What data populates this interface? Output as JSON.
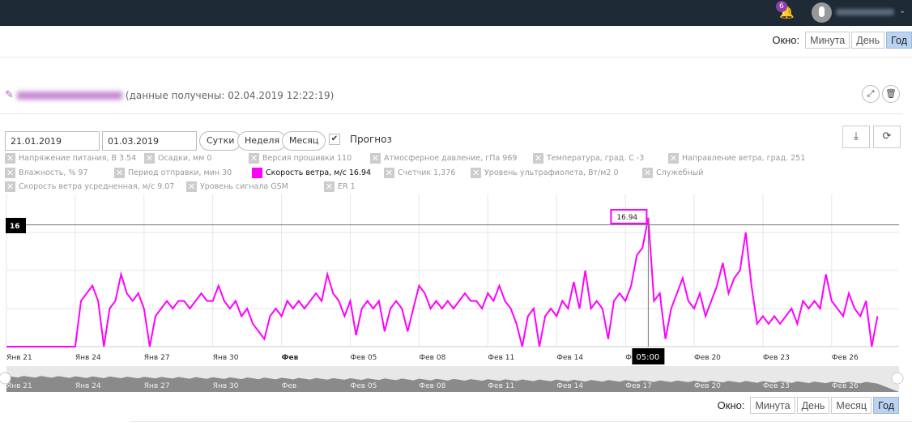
{
  "header": {
    "notifications": "6"
  },
  "window_top": {
    "label": "Окно:",
    "options": [
      "Минута",
      "День",
      "Год"
    ],
    "active": "Год"
  },
  "station": {
    "received": "(данные получены: 02.04.2019 12:22:19)"
  },
  "controls": {
    "date_from": "21.01.2019",
    "date_to": "01.03.2019",
    "ranges": [
      "Сутки",
      "Неделя",
      "Месяц"
    ],
    "forecast_label": "Прогноз",
    "forecast_checked": true
  },
  "legend": [
    {
      "label": "Напряжение питания, В 3.54",
      "on": false
    },
    {
      "label": "Осадки, мм 0",
      "on": false
    },
    {
      "label": "Версия прошивки 110",
      "on": false
    },
    {
      "label": "Атмосферное давление, гПа 969",
      "on": false
    },
    {
      "label": "Температура, град. С -3",
      "on": false
    },
    {
      "label": "Направление ветра, град. 251",
      "on": false
    },
    {
      "label": "Влажность, % 97",
      "on": false
    },
    {
      "label": "Период отправки, мин 30",
      "on": false
    },
    {
      "label": "Скорость ветра, м/с 16.94",
      "on": true,
      "color": "#ff00ff"
    },
    {
      "label": "Счетчик 1,376",
      "on": false
    },
    {
      "label": "Уровень ультрафиолета, Вт/м2 0",
      "on": false
    },
    {
      "label": "Служебный",
      "on": false
    },
    {
      "label": "Скорость ветра усредненная, м/с 9.07",
      "on": false
    },
    {
      "label": "Уровень сигнала GSM",
      "on": false
    },
    {
      "label": "ER 1",
      "on": false
    }
  ],
  "chart_data": {
    "type": "line",
    "series_color": "#ff00ff",
    "x_range": [
      "2019-01-21",
      "2019-02-28T23:00"
    ],
    "y_range": [
      0,
      17.5
    ],
    "y_grid": [
      0,
      5,
      10,
      15
    ],
    "crosshair": {
      "y_label": "16",
      "value_label": "16.94",
      "time_label": "05:00"
    },
    "x_ticks": [
      "Янв 21",
      "Янв 24",
      "Янв 27",
      "Янв 30",
      "Фев",
      "Фев 05",
      "Фев 08",
      "Фев 11",
      "Фев 14",
      "Фев 17",
      "Фев 20",
      "Фев 23",
      "Фев 26"
    ],
    "navigator_ticks": [
      "Янв 21",
      "Янв 24",
      "Янв 27",
      "Янв 30",
      "Фев",
      "Фев 05",
      "Фев 08",
      "Фев 11",
      "Фев 14",
      "Фев 17",
      "Фев 20",
      "Фев 23",
      "Фев 26"
    ],
    "series": [
      {
        "values_every_6h_from": "2019-01-21T00:00",
        "values": [
          0,
          0,
          0,
          0,
          0,
          0,
          0,
          0,
          0,
          0,
          0,
          0,
          0,
          6,
          7,
          8,
          6,
          0,
          5,
          6,
          9.5,
          7,
          6,
          7,
          5,
          0,
          4,
          5,
          6,
          5,
          6,
          6,
          5,
          6,
          7,
          6,
          6,
          8,
          6,
          5,
          6,
          4,
          5,
          3,
          2,
          1,
          4,
          5,
          4,
          6,
          5,
          6,
          5,
          6,
          7,
          6,
          9.5,
          7,
          6,
          4,
          6,
          1.5,
          5,
          6,
          5,
          6,
          2,
          5,
          6,
          5,
          2,
          5,
          8,
          7,
          5,
          6,
          5,
          6,
          5,
          6,
          7,
          6,
          6,
          5,
          7,
          6,
          8,
          6,
          5,
          3,
          0,
          4,
          5,
          0,
          4,
          5,
          4,
          6,
          5,
          8.5,
          5,
          10,
          5,
          6,
          5,
          1,
          6,
          7,
          6,
          8,
          12,
          13,
          16.94,
          6,
          7,
          1,
          5,
          7,
          9,
          6,
          5,
          7,
          4,
          6,
          8,
          11,
          7,
          9,
          10,
          15,
          8,
          3,
          4,
          3,
          4,
          3,
          4,
          5,
          3,
          6,
          5,
          6,
          5,
          9.5,
          6,
          5,
          4,
          7,
          5,
          4,
          6,
          0,
          4
        ]
      }
    ]
  },
  "window_bottom": {
    "label": "Окно:",
    "options": [
      "Минута",
      "День",
      "Месяц",
      "Год"
    ],
    "active": "Год"
  }
}
